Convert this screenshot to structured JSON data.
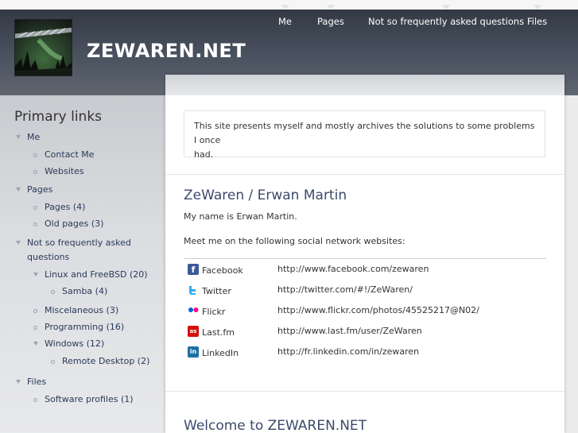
{
  "site": {
    "name": "ZEWAREN.NET"
  },
  "nav": {
    "items": [
      {
        "label": "Me"
      },
      {
        "label": "Pages"
      },
      {
        "label": "Not so frequently asked questions"
      },
      {
        "label": "Files"
      }
    ]
  },
  "sidebar": {
    "title": "Primary links",
    "items": [
      {
        "label": "Me"
      },
      {
        "label": "Contact Me"
      },
      {
        "label": "Websites"
      },
      {
        "label": "Pages"
      },
      {
        "label": "Pages (4)"
      },
      {
        "label": "Old pages (3)"
      },
      {
        "label": "Not so frequently asked"
      },
      {
        "label": "questions"
      },
      {
        "label": "Linux and FreeBSD (20)"
      },
      {
        "label": "Samba (4)"
      },
      {
        "label": "Miscelaneous (3)"
      },
      {
        "label": "Programming (16)"
      },
      {
        "label": "Windows (12)"
      },
      {
        "label": "Remote Desktop (2)"
      },
      {
        "label": "Files"
      },
      {
        "label": "Software profiles (1)"
      }
    ]
  },
  "main": {
    "intro_line1": "This site presents myself and mostly archives the solutions to some problems I once",
    "intro_line2": "had.",
    "section1_title": "ZeWaren / Erwan Martin",
    "para1": "My name is Erwan Martin.",
    "para2": "Meet me on the following social network websites:",
    "social": [
      {
        "name": "Facebook",
        "url": "http://www.facebook.com/zewaren",
        "icon": "facebook-icon"
      },
      {
        "name": "Twitter",
        "url": "http://twitter.com/#!/ZeWaren/",
        "icon": "twitter-icon"
      },
      {
        "name": "Flickr",
        "url": "http://www.flickr.com/photos/45525217@N02/",
        "icon": "flickr-icon"
      },
      {
        "name": "Last.fm",
        "url": "http://www.last.fm/user/ZeWaren",
        "icon": "lastfm-icon"
      },
      {
        "name": "LinkedIn",
        "url": "http://fr.linkedin.com/in/zewaren",
        "icon": "linkedin-icon"
      }
    ],
    "section2_title": "Welcome to ZEWAREN.NET"
  },
  "colors": {
    "header_dark": "#333a45",
    "link": "#2a3a5a",
    "title": "#3b4a6b"
  }
}
